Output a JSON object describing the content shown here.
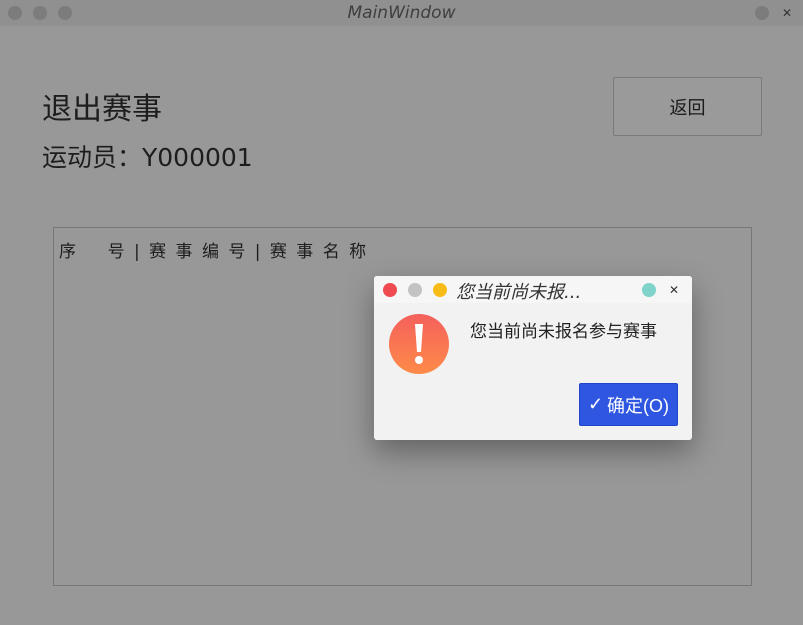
{
  "window": {
    "title": "MainWindow"
  },
  "page": {
    "heading": "退出赛事",
    "athlete_label": "运动员：Y000001",
    "back_button": "返回",
    "list_header": "序    号 | 赛 事 编 号 | 赛 事 名 称"
  },
  "dialog": {
    "title": "您当前尚未报...",
    "message": "您当前尚未报名参与赛事",
    "ok_button": "确定(O)",
    "icons": {
      "warning": "exclamation-warning-icon",
      "ok": "checkmark-icon"
    },
    "colors": {
      "close_dot": "#ef4b51",
      "min_dot": "#c3c3c3",
      "max_dot": "#f8bb18",
      "ok_button": "#2e56e0",
      "warning_top": "#f4605c",
      "warning_bottom": "#fe8b49"
    }
  }
}
